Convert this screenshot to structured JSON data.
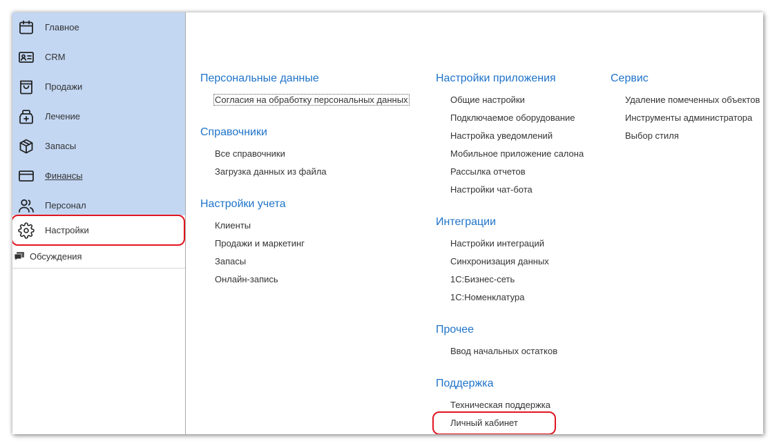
{
  "sidebar": {
    "sections": [
      {
        "label": "Главное",
        "icon": "calendar-icon"
      },
      {
        "label": "CRM",
        "icon": "contact-card-icon"
      },
      {
        "label": "Продажи",
        "icon": "shopping-bag-icon"
      },
      {
        "label": "Лечение",
        "icon": "medical-bag-icon"
      },
      {
        "label": "Запасы",
        "icon": "package-icon"
      },
      {
        "label": "Финансы",
        "icon": "credit-card-icon"
      },
      {
        "label": "Персонал",
        "icon": "people-icon"
      },
      {
        "label": "Настройки",
        "icon": "gear-icon"
      }
    ],
    "discussions": {
      "label": "Обсуждения",
      "icon": "chat-bubbles-icon"
    }
  },
  "main": {
    "groups": {
      "personal_data": {
        "title": "Персональные данные",
        "items": [
          "Согласия на обработку персональных данных"
        ]
      },
      "references": {
        "title": "Справочники",
        "items": [
          "Все справочники",
          "Загрузка данных из файла"
        ]
      },
      "accounting_settings": {
        "title": "Настройки учета",
        "items": [
          "Клиенты",
          "Продажи и маркетинг",
          "Запасы",
          "Онлайн-запись"
        ]
      },
      "app_settings": {
        "title": "Настройки приложения",
        "items": [
          "Общие настройки",
          "Подключаемое оборудование",
          "Настройка уведомлений",
          "Мобильное приложение салона",
          "Рассылка отчетов",
          "Настройки чат-бота"
        ]
      },
      "integrations": {
        "title": "Интеграции",
        "items": [
          "Настройки интеграций",
          "Синхронизация данных",
          "1С:Бизнес-сеть",
          "1С:Номенклатура"
        ]
      },
      "other": {
        "title": "Прочее",
        "items": [
          "Ввод начальных остатков"
        ]
      },
      "support": {
        "title": "Поддержка",
        "items": [
          "Техническая поддержка",
          "Личный кабинет"
        ]
      },
      "service": {
        "title": "Сервис",
        "items": [
          "Удаление помеченных объектов",
          "Инструменты администратора",
          "Выбор стиля"
        ]
      }
    }
  },
  "colors": {
    "sidebar_bg": "#c3d7f3",
    "group_title": "#1e73c9",
    "highlight": "#e1141e"
  }
}
